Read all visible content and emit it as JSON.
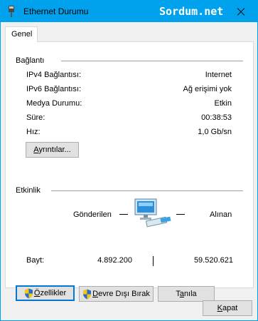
{
  "window": {
    "title": "Ethernet Durumu",
    "watermark": "Sordum.net"
  },
  "tabs": [
    {
      "label": "Genel"
    }
  ],
  "connection": {
    "section_title": "Bağlantı",
    "rows": [
      {
        "label": "IPv4 Bağlantısı:",
        "value": "Internet"
      },
      {
        "label": "IPv6 Bağlantısı:",
        "value": "Ağ erişimi yok"
      },
      {
        "label": "Medya Durumu:",
        "value": "Etkin"
      },
      {
        "label": "Süre:",
        "value": "00:38:53"
      },
      {
        "label": "Hız:",
        "value": "1,0 Gb/sn"
      }
    ],
    "details_button": {
      "accel": "A",
      "rest": "yrıntılar..."
    }
  },
  "activity": {
    "section_title": "Etkinlik",
    "sent_label": "Gönderilen",
    "received_label": "Alınan",
    "bytes_label": "Bayt:",
    "bytes_sent": "4.892.200",
    "bytes_received": "59.520.621"
  },
  "buttons": {
    "properties": {
      "accel": "Ö",
      "rest": "zellikler"
    },
    "disable": {
      "accel": "D",
      "rest": "evre Dışı Bırak"
    },
    "diagnose": {
      "pre": "T",
      "accel": "a",
      "rest": "nıla"
    },
    "close": {
      "accel": "K",
      "rest": "apat"
    }
  },
  "colors": {
    "title_bar": "#00a2ed",
    "client_bg": "#f0f0f0",
    "focus_border": "#0078d7"
  }
}
